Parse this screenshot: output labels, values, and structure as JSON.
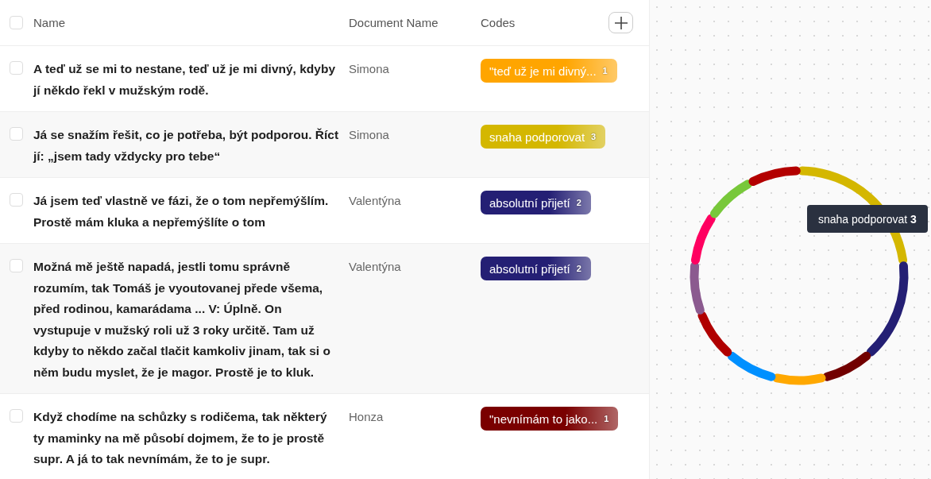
{
  "table": {
    "columns": [
      {
        "label": "Name"
      },
      {
        "label": "Document Name"
      },
      {
        "label": "Codes"
      }
    ],
    "header_checked": false,
    "rows": [
      {
        "checked": false,
        "name": "A teď už se mi to nestane, teď už je mi divný, kdyby jí někdo řekl v mužským rodě.",
        "document": "Simona",
        "code": {
          "label": "\"teď už je mi divný...",
          "count": "1",
          "color": "#ffa500"
        }
      },
      {
        "checked": false,
        "name": "Já se snažím řešit, co je potřeba, být podporou. Říct jí: „jsem tady vždycky pro tebe“",
        "document": "Simona",
        "code": {
          "label": "snaha podporovat",
          "count": "3",
          "color": "#d4b700"
        }
      },
      {
        "checked": false,
        "name": "Já jsem teď vlastně ve fázi, že o tom nepřemýšlím. Prostě mám kluka a nepřemýšlíte o tom",
        "document": "Valentýna",
        "code": {
          "label": "absolutní přijetí",
          "count": "2",
          "color": "#241f74"
        }
      },
      {
        "checked": false,
        "name": "Možná mě ještě napadá, jestli tomu správně rozumím, tak Tomáš je vyoutovanej přede všema, před rodinou, kamarádama ... V: Úplně. On vystupuje v mužský roli už 3 roky určitě. Tam už kdyby to někdo začal tlačit kamkoliv jinam, tak si o něm budu myslet, že je magor. Prostě je to kluk.",
        "document": "Valentýna",
        "code": {
          "label": "absolutní přijetí",
          "count": "2",
          "color": "#241f74"
        }
      },
      {
        "checked": false,
        "name": "Když chodíme na schůzky s rodičema, tak některý ty maminky na mě působí dojmem, že to je prostě supr. A já to tak nevnímám, že to je supr.",
        "document": "Honza",
        "code": {
          "label": "\"nevnímám to jako...",
          "count": "1",
          "color": "#7a0000"
        }
      }
    ]
  },
  "ring": {
    "segments": [
      {
        "color": "#d4b700",
        "kind": "long"
      },
      {
        "color": "#241f74",
        "kind": "medium"
      },
      {
        "color": "#720000",
        "kind": "short"
      },
      {
        "color": "#ffa800",
        "kind": "short"
      },
      {
        "color": "#0090ff",
        "kind": "short"
      },
      {
        "color": "#b00000",
        "kind": "short"
      },
      {
        "color": "#8b5a8f",
        "kind": "short"
      },
      {
        "color": "#ff0060",
        "kind": "short"
      },
      {
        "color": "#78c83a",
        "kind": "short"
      },
      {
        "color": "#b30000",
        "kind": "short"
      }
    ],
    "tooltip": "snaha podporovat **3**"
  }
}
